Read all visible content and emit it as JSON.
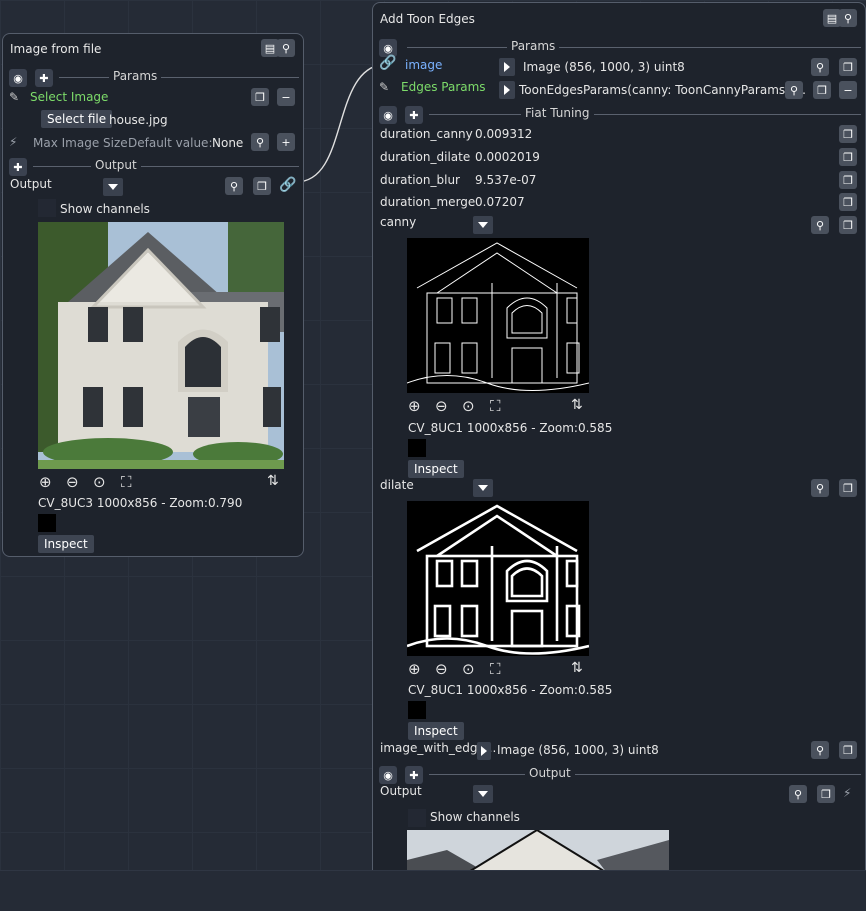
{
  "left_node": {
    "title": "Image from file",
    "params_label": "Params",
    "select_image_label": "Select Image",
    "select_file_button": "Select file",
    "filename": "house.jpg",
    "max_image_size_label": "Max Image Size",
    "default_value_label": "Default value:",
    "default_value": "None",
    "output_section_label": "Output",
    "output_label": "Output",
    "show_channels_label": "Show channels",
    "image_info": "CV_8UC3 1000x856 - Zoom:0.790",
    "inspect_button": "Inspect"
  },
  "right_node": {
    "title": "Add Toon Edges",
    "params_label": "Params",
    "image_input_label": "image",
    "image_input_value": "Image (856, 1000, 3) uint8",
    "edges_params_label": "Edges Params",
    "edges_params_value": "ToonEdgesParams(canny: ToonCannyParams(t...",
    "fiat_tuning_label": "Fiat Tuning",
    "durations": [
      {
        "name": "duration_canny",
        "value": "0.009312"
      },
      {
        "name": "duration_dilate",
        "value": "0.0002019"
      },
      {
        "name": "duration_blur",
        "value": "9.537e-07"
      },
      {
        "name": "duration_merge",
        "value": "0.07207"
      }
    ],
    "canny_label": "canny",
    "canny_info": "CV_8UC1 1000x856 - Zoom:0.585",
    "dilate_label": "dilate",
    "dilate_info": "CV_8UC1 1000x856 - Zoom:0.585",
    "inspect_button": "Inspect",
    "image_with_edges_label": "image_with_edge...",
    "image_with_edges_value": "Image (856, 1000, 3) uint8",
    "output_section_label": "Output",
    "output_label": "Output",
    "show_channels_label": "Show channels"
  },
  "colors": {
    "background": "#252b36",
    "node_bg": "#1e232c",
    "green_label": "#7ddc6a",
    "link_blue": "#7ab2ff"
  }
}
